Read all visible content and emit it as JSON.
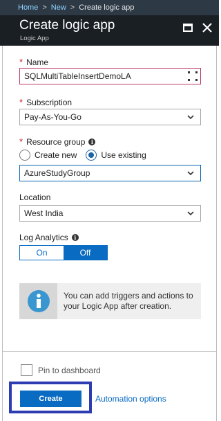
{
  "breadcrumb": {
    "home": "Home",
    "new": "New",
    "current": "Create logic app",
    "separator": ">"
  },
  "header": {
    "title": "Create logic app",
    "subtitle": "Logic App"
  },
  "form": {
    "name": {
      "label": "Name",
      "value": "SQLMultiTableInsertDemoLA"
    },
    "subscription": {
      "label": "Subscription",
      "value": "Pay-As-You-Go"
    },
    "resource_group": {
      "label": "Resource group",
      "options": [
        "Create new",
        "Use existing"
      ],
      "selected": "Use existing",
      "value": "AzureStudyGroup"
    },
    "location": {
      "label": "Location",
      "value": "West India"
    },
    "log_analytics": {
      "label": "Log Analytics",
      "on_label": "On",
      "off_label": "Off",
      "selected": "Off"
    }
  },
  "info_box": {
    "text": "You can add triggers and actions to your Logic App after creation."
  },
  "footer": {
    "pin_label": "Pin to dashboard",
    "create_label": "Create",
    "automation_label": "Automation options"
  },
  "colors": {
    "accent": "#0a6bc2",
    "header_bg": "#1a1f24",
    "breadcrumb_bg": "#2d3a46",
    "required": "#c4262e",
    "highlight_border": "#2d3cb0"
  },
  "icons": [
    "maximize-icon",
    "close-icon",
    "chevron-down-icon",
    "info-icon",
    "resize-corner-icon"
  ]
}
